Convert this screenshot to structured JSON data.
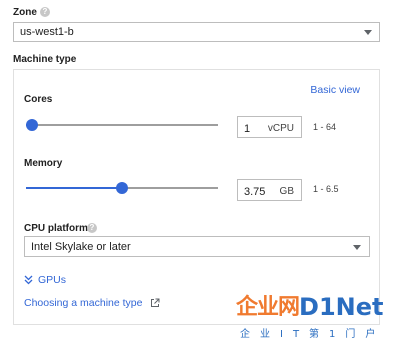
{
  "zone": {
    "label": "Zone",
    "help_icon": "?",
    "value": "us-west1-b"
  },
  "machine_type": {
    "label": "Machine type",
    "basic_view_link": "Basic view",
    "cores": {
      "label": "Cores",
      "value": "1",
      "unit": "vCPU",
      "range": "1 - 64",
      "slider_fraction": 0.0
    },
    "memory": {
      "label": "Memory",
      "value": "3.75",
      "unit": "GB",
      "range": "1 - 6.5",
      "slider_fraction": 0.5
    },
    "cpu_platform": {
      "label": "CPU platform",
      "help_icon": "?",
      "value": "Intel Skylake or later"
    },
    "gpus_link": "GPUs",
    "gpus_icon": "double-chevron-down-icon",
    "choosing_link": "Choosing a machine type",
    "external_icon": "open-in-new-icon"
  },
  "watermark": {
    "part1": "企业网",
    "part2": "D1Net",
    "tagline": "企业IT第1门户"
  },
  "colors": {
    "accent": "#3367d6",
    "watermark_orange": "#f07a2f",
    "watermark_blue": "#2a6dc0"
  }
}
